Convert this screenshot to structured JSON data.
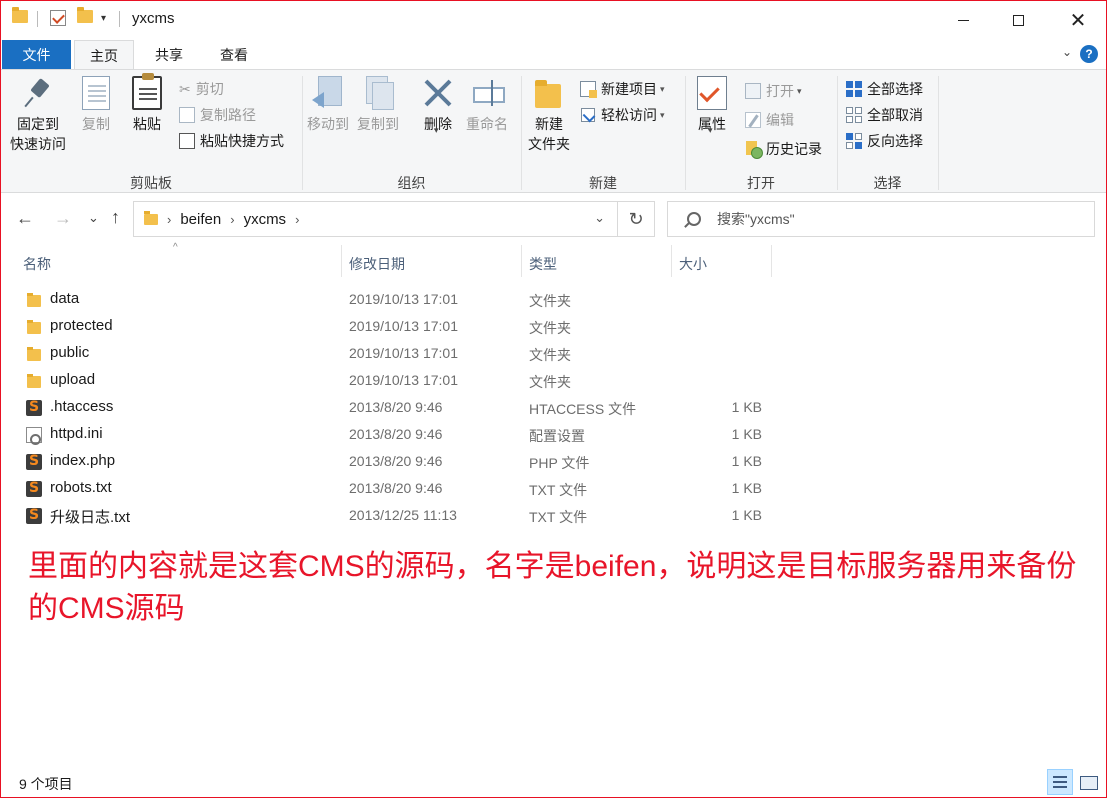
{
  "window": {
    "title": "yxcms",
    "controls": {
      "minimize_icon": "minimize-icon",
      "maximize_icon": "maximize-icon",
      "close": "✕"
    }
  },
  "ribbon_tabs": [
    {
      "label": "文件"
    },
    {
      "label": "主页"
    },
    {
      "label": "共享"
    },
    {
      "label": "查看"
    }
  ],
  "ribbon": {
    "clipboard": {
      "label": "剪贴板",
      "pin_line1": "固定到",
      "pin_line2": "快速访问",
      "copy": "复制",
      "paste": "粘贴",
      "cut": "剪切",
      "copy_path": "复制路径",
      "paste_shortcut": "粘贴快捷方式"
    },
    "organize": {
      "label": "组织",
      "move_to": "移动到",
      "copy_to": "复制到",
      "delete": "删除",
      "rename": "重命名"
    },
    "new": {
      "label": "新建",
      "new_folder_line1": "新建",
      "new_folder_line2": "文件夹",
      "new_item": "新建项目",
      "easy_access": "轻松访问"
    },
    "open": {
      "label": "打开",
      "properties": "属性",
      "open": "打开",
      "edit": "编辑",
      "history": "历史记录"
    },
    "select": {
      "label": "选择",
      "select_all": "全部选择",
      "select_none": "全部取消",
      "invert": "反向选择"
    }
  },
  "address": {
    "breadcrumb": [
      "beifen",
      "yxcms"
    ],
    "search_placeholder": "搜索\"yxcms\""
  },
  "columns": {
    "name": "名称",
    "date": "修改日期",
    "type": "类型",
    "size": "大小"
  },
  "files": [
    {
      "icon": "folder-icon",
      "name": "data",
      "date": "2019/10/13 17:01",
      "type": "文件夹",
      "size": ""
    },
    {
      "icon": "folder-icon",
      "name": "protected",
      "date": "2019/10/13 17:01",
      "type": "文件夹",
      "size": ""
    },
    {
      "icon": "folder-icon",
      "name": "public",
      "date": "2019/10/13 17:01",
      "type": "文件夹",
      "size": ""
    },
    {
      "icon": "folder-icon",
      "name": "upload",
      "date": "2019/10/13 17:01",
      "type": "文件夹",
      "size": ""
    },
    {
      "icon": "sublime-file-icon",
      "name": ".htaccess",
      "date": "2013/8/20 9:46",
      "type": "HTACCESS 文件",
      "size": "1 KB"
    },
    {
      "icon": "settings-file-icon",
      "name": "httpd.ini",
      "date": "2013/8/20 9:46",
      "type": "配置设置",
      "size": "1 KB"
    },
    {
      "icon": "sublime-file-icon",
      "name": "index.php",
      "date": "2013/8/20 9:46",
      "type": "PHP 文件",
      "size": "1 KB"
    },
    {
      "icon": "sublime-file-icon",
      "name": "robots.txt",
      "date": "2013/8/20 9:46",
      "type": "TXT 文件",
      "size": "1 KB"
    },
    {
      "icon": "sublime-file-icon",
      "name": "升级日志.txt",
      "date": "2013/12/25 11:13",
      "type": "TXT 文件",
      "size": "1 KB"
    }
  ],
  "annotation": "里面的内容就是这套CMS的源码，名字是beifen，说明这是目标服务器用来备份的CMS源码",
  "status": {
    "count": "9 个项目"
  },
  "colors": {
    "accent": "#1a6fc2",
    "folder": "#f3c04c",
    "annotation": "#e8152a"
  }
}
